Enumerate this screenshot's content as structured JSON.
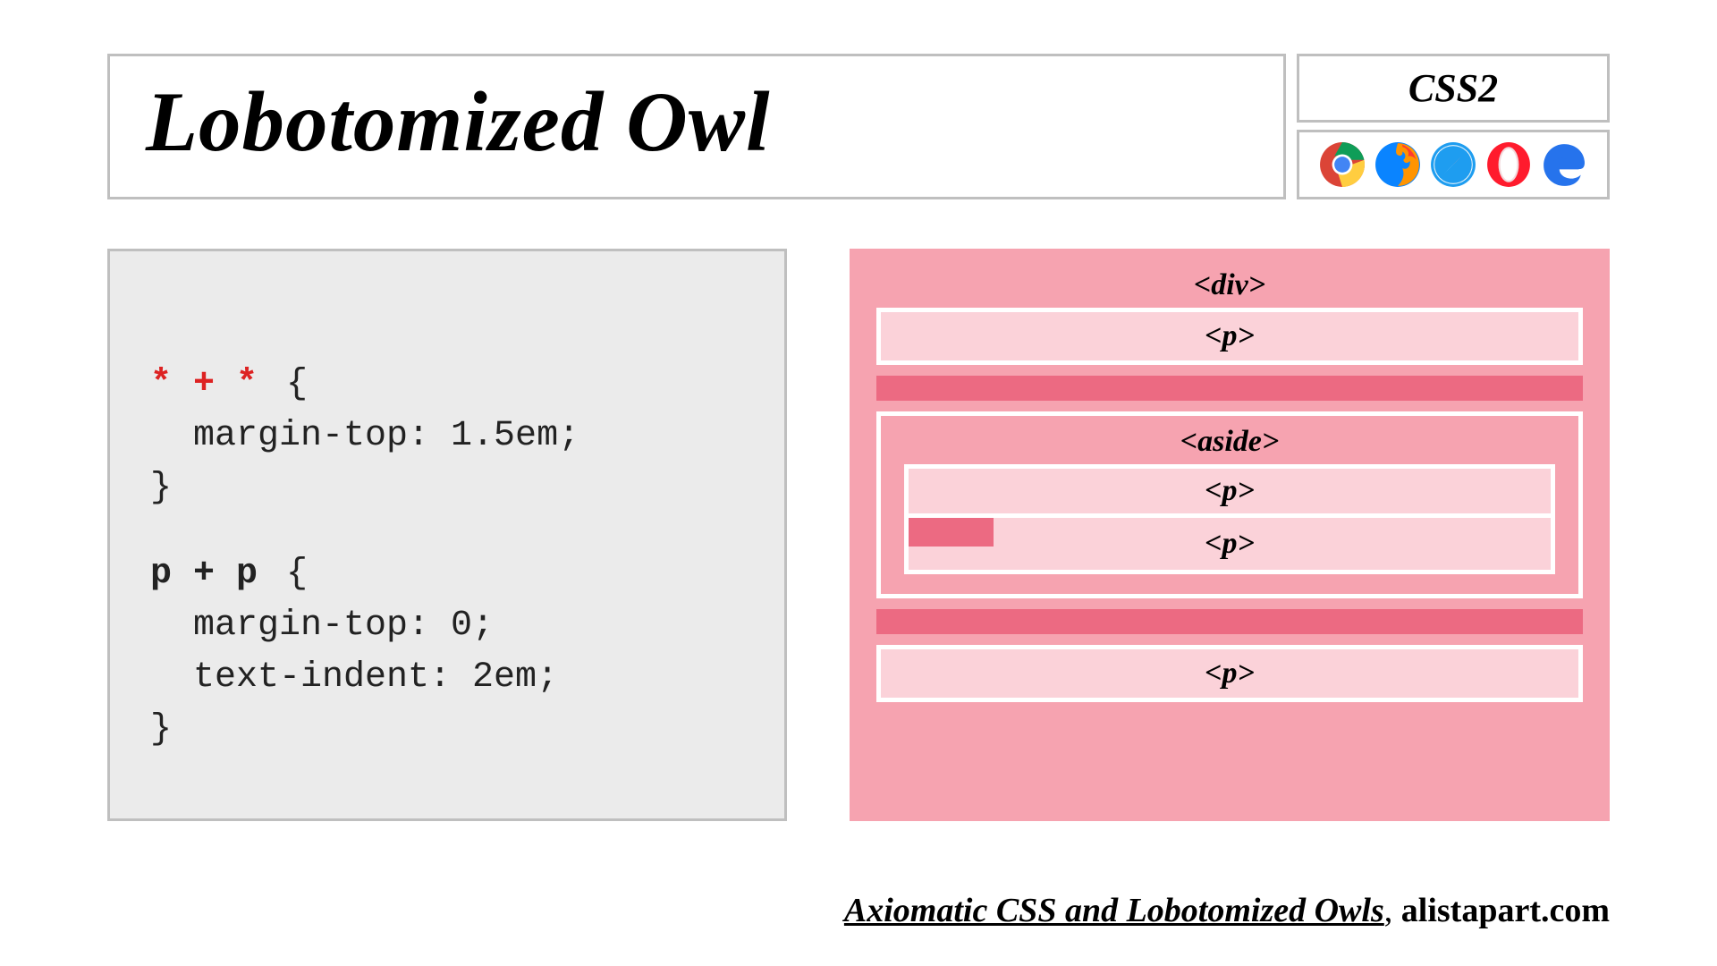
{
  "header": {
    "title": "Lobotomized Owl",
    "css_version": "CSS2",
    "browsers": [
      "chrome",
      "firefox",
      "safari",
      "opera",
      "edge"
    ]
  },
  "code": {
    "rule1": {
      "selector": "* + *",
      "open": "{",
      "lines": [
        "margin-top: 1.5em;"
      ],
      "close": "}"
    },
    "rule2": {
      "selector": "p + p",
      "open": "{",
      "lines": [
        "margin-top: 0;",
        "text-indent: 2em;"
      ],
      "close": "}"
    }
  },
  "diagram": {
    "div_label": "<div>",
    "p_label": "<p>",
    "aside_label": "<aside>"
  },
  "footer": {
    "reference_title": "Axiomatic CSS and Lobotomized Owls",
    "separator": ", ",
    "reference_source": "alistapart.com"
  }
}
